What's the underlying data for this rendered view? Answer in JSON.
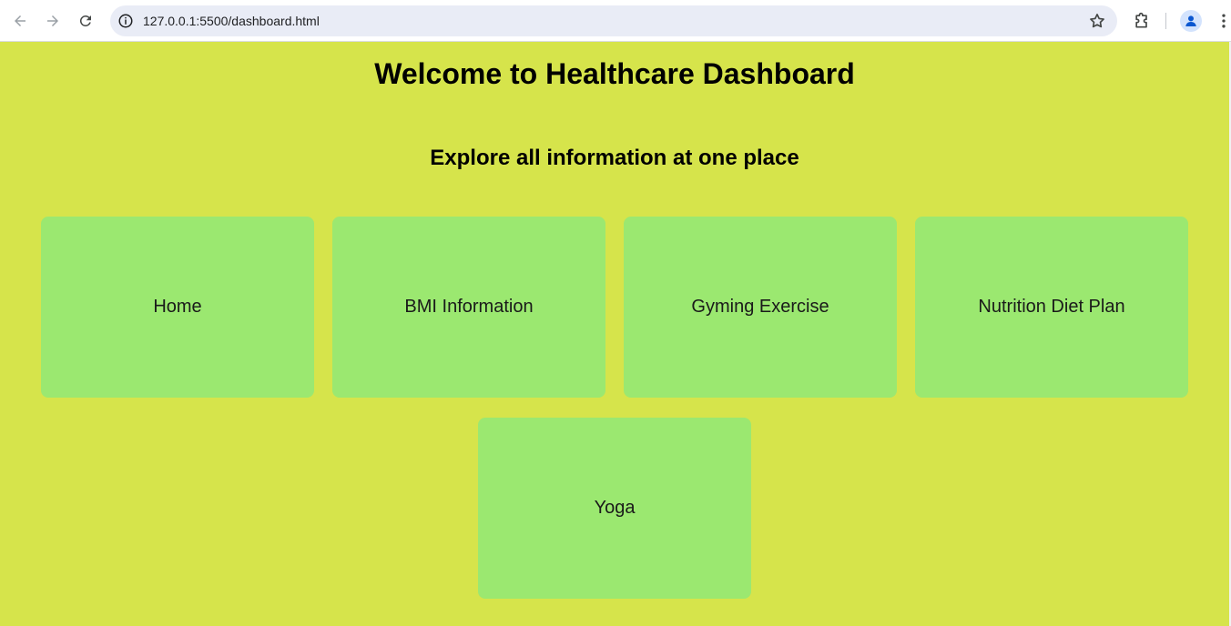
{
  "browser": {
    "url": "127.0.0.1:5500/dashboard.html",
    "icons": {
      "back": "back-arrow-icon",
      "forward": "forward-arrow-icon",
      "reload": "reload-icon",
      "site_info": "info-icon",
      "bookmark": "star-icon",
      "extensions": "puzzle-icon",
      "profile": "person-icon",
      "menu": "kebab-menu-icon"
    }
  },
  "header": {
    "title": "Welcome to Healthcare Dashboard",
    "subtitle": "Explore all information at one place"
  },
  "cards": [
    {
      "label": "Home"
    },
    {
      "label": "BMI Information"
    },
    {
      "label": "Gyming Exercise"
    },
    {
      "label": "Nutrition Diet Plan"
    },
    {
      "label": "Yoga"
    }
  ],
  "colors": {
    "page_background": "#d6e44b",
    "card_background": "#9be870"
  }
}
